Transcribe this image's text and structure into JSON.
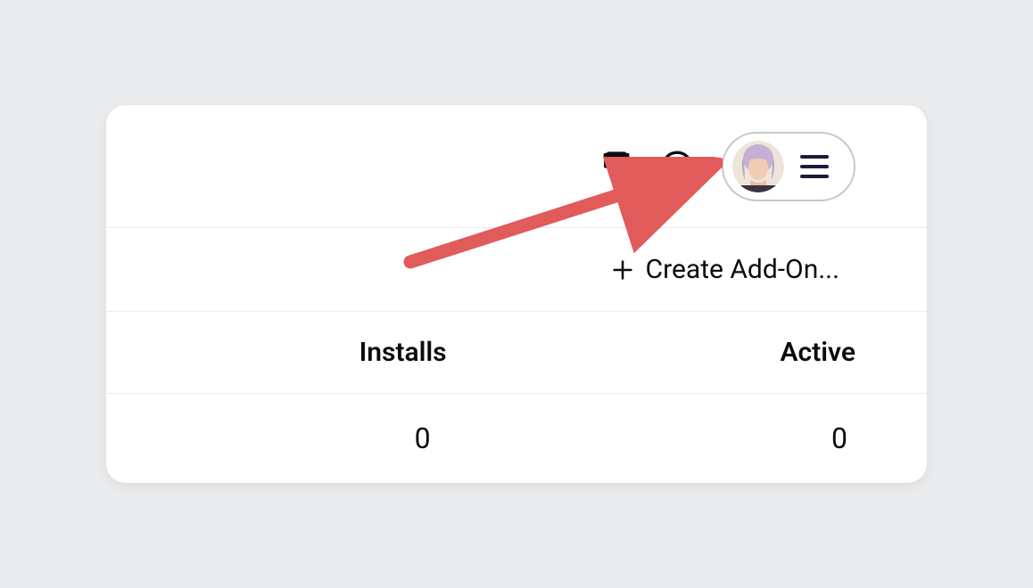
{
  "header": {
    "avatar": "user-avatar",
    "hamburger": "menu"
  },
  "create": {
    "label": "Create Add-On..."
  },
  "table": {
    "columns": {
      "installs": "Installs",
      "active": "Active"
    },
    "rows": [
      {
        "installs": "0",
        "active": "0"
      }
    ]
  }
}
